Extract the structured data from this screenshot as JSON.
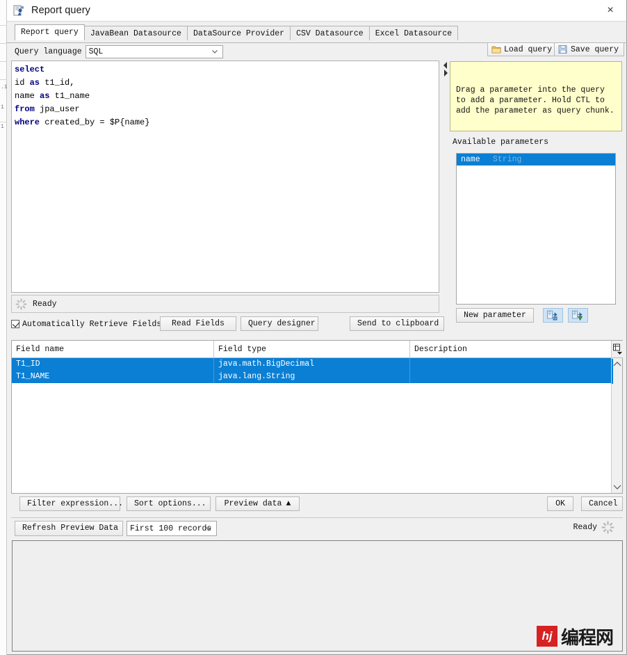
{
  "window": {
    "title": "Report query",
    "icon": "app-icon",
    "close_label": "×"
  },
  "tabs": [
    {
      "label": "Report query",
      "active": true
    },
    {
      "label": "JavaBean Datasource",
      "active": false
    },
    {
      "label": "DataSource Provider",
      "active": false
    },
    {
      "label": "CSV Datasource",
      "active": false
    },
    {
      "label": "Excel Datasource",
      "active": false
    }
  ],
  "toolbar": {
    "query_language_label": "Query language",
    "query_language_value": "SQL",
    "query_language_options": [
      "SQL"
    ],
    "load_query_label": "Load query",
    "save_query_label": "Save query"
  },
  "editor": {
    "lines": [
      [
        {
          "t": "select",
          "kw": true
        }
      ],
      [
        {
          "t": "id ",
          "kw": false
        },
        {
          "t": "as",
          "kw": true
        },
        {
          "t": " t1_id,",
          "kw": false
        }
      ],
      [
        {
          "t": "name ",
          "kw": false
        },
        {
          "t": "as",
          "kw": true
        },
        {
          "t": " t1_name",
          "kw": false
        }
      ],
      [
        {
          "t": "from",
          "kw": true
        },
        {
          "t": " jpa_user",
          "kw": false
        }
      ],
      [
        {
          "t": "where",
          "kw": true
        },
        {
          "t": " created_by = $P{name}",
          "kw": false
        }
      ]
    ],
    "status_text": "Ready",
    "spinner_icon": "spinner-icon"
  },
  "actions": {
    "auto_retrieve_label": "Automatically Retrieve Fields",
    "auto_retrieve_checked": true,
    "read_fields_label": "Read Fields",
    "query_designer_label": "Query designer",
    "send_to_clipboard_label": "Send to clipboard"
  },
  "parameters_panel": {
    "hint_text": "Drag a parameter into the query to add a parameter. Hold CTL to add the parameter as query chunk.",
    "available_label": "Available parameters",
    "items": [
      {
        "name": "name",
        "type": "String",
        "selected": true
      }
    ],
    "new_parameter_label": "New parameter",
    "import_icon": "parameter-import-icon",
    "export_icon": "parameter-export-icon"
  },
  "fields_table": {
    "columns": [
      "Field name",
      "Field type",
      "Description"
    ],
    "rows": [
      {
        "name": "T1_ID",
        "type": "java.math.BigDecimal",
        "description": ""
      },
      {
        "name": "T1_NAME",
        "type": "java.lang.String",
        "description": ""
      }
    ],
    "column_picker_icon": "column-picker-icon",
    "scroll_up_icon": "chevron-up-icon",
    "scroll_down_icon": "chevron-down-icon"
  },
  "bottom_bar": {
    "filter_expression_label": "Filter expression...",
    "sort_options_label": "Sort options...",
    "preview_data_label": "Preview data",
    "preview_data_arrow": "▲",
    "ok_label": "OK",
    "cancel_label": "Cancel"
  },
  "preview_bar": {
    "refresh_label": "Refresh Preview Data",
    "records_value": "First 100 records",
    "records_options": [
      "First 100 records"
    ],
    "status_text": "Ready",
    "spinner_icon": "spinner-icon"
  },
  "watermark": {
    "badge": "hj",
    "text": "编程网"
  },
  "colors": {
    "selection_blue": "#0a7fd4",
    "hint_yellow": "#ffffcc",
    "keyword_navy": "#000080",
    "window_bg": "#f0f0f0",
    "watermark_red": "#d62222"
  }
}
